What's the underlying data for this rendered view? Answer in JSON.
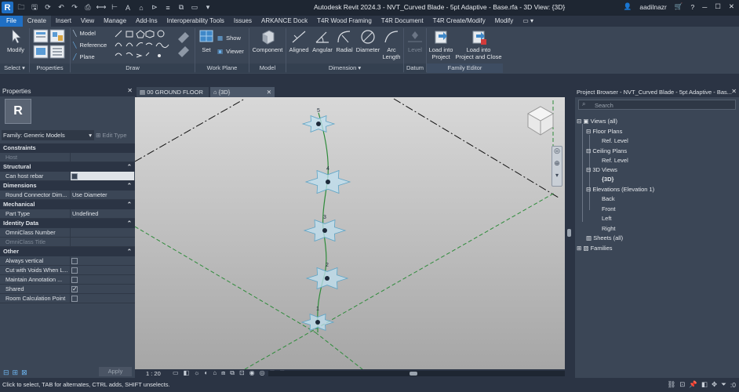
{
  "title": "Autodesk Revit 2024.3 - NVT_Curved Blade - 5pt Adaptive - Base.rfa - 3D View: {3D}",
  "user": "aadilnazr",
  "logo_letter": "R",
  "menu_tabs": [
    "File",
    "Create",
    "Insert",
    "View",
    "Manage",
    "Add-Ins",
    "Interoperability Tools",
    "Issues",
    "ARKANCE Dock",
    "T4R Wood Framing",
    "T4R Document",
    "T4R Create/Modify",
    "Modify"
  ],
  "ribbon": {
    "modify": "Modify",
    "model": "Model",
    "reference": "Reference",
    "plane": "Plane",
    "set": "Set",
    "show": "Show",
    "viewer": "Viewer",
    "component": "Component",
    "aligned": "Aligned",
    "angular": "Angular",
    "radial": "Radial",
    "diameter": "Diameter",
    "arc_length": [
      "Arc",
      "Length"
    ],
    "level": "Level",
    "load_into_project": [
      "Load into",
      "Project"
    ],
    "load_into_project_close": [
      "Load into",
      "Project and Close"
    ],
    "panels": {
      "select": "Select",
      "properties": "Properties",
      "draw": "Draw",
      "work_plane": "Work Plane",
      "model": "Model",
      "dimension": "Dimension",
      "datum": "Datum",
      "family_editor": "Family Editor"
    }
  },
  "properties": {
    "title": "Properties",
    "family": "Family: Generic Models",
    "edit_type": "Edit Type",
    "apply": "Apply",
    "sections": {
      "constraints": "Constraints",
      "structural": "Structural",
      "dimensions": "Dimensions",
      "mechanical": "Mechanical",
      "identity": "Identity Data",
      "other": "Other"
    },
    "rows": {
      "host": "Host",
      "can_host_rebar": "Can host rebar",
      "round_connector": "Round Connector Dim...",
      "round_connector_val": "Use Diameter",
      "part_type": "Part Type",
      "part_type_val": "Undefined",
      "omniclass_number": "OmniClass Number",
      "omniclass_title": "OmniClass Title",
      "always_vertical": "Always vertical",
      "cut_with_voids": "Cut with Voids When L...",
      "maintain_annotation": "Maintain Annotation ...",
      "shared": "Shared",
      "room_calc_point": "Room Calculation Point"
    },
    "checks": {
      "can_host_rebar": false,
      "always_vertical": false,
      "cut_with_voids": false,
      "maintain_annotation": false,
      "shared": true,
      "room_calc_point": false
    }
  },
  "view_tabs": [
    "00 GROUND FLOOR",
    "{3D}"
  ],
  "view_scale": "1 : 20",
  "points": [
    "5",
    "4",
    "3",
    "2",
    "1"
  ],
  "browser": {
    "title": "Project Browser - NVT_Curved Blade - 5pt Adaptive - Bas...",
    "search_placeholder": "Search",
    "views_all": "Views (all)",
    "floor_plans": "Floor Plans",
    "ref_level_1": "Ref. Level",
    "ceiling_plans": "Ceiling Plans",
    "ref_level_2": "Ref. Level",
    "views_3d": "3D Views",
    "view_3d": "{3D}",
    "elevations": "Elevations (Elevation 1)",
    "back": "Back",
    "front": "Front",
    "left": "Left",
    "right": "Right",
    "sheets": "Sheets (all)",
    "families": "Families"
  },
  "status": "Click to select, TAB for alternates, CTRL adds, SHIFT unselects.",
  "status_filter_count": ":0",
  "colors": {
    "file_tab": "#1f6fc4",
    "panel": "#3b4656",
    "dark": "#2b3444",
    "point": "#bfe0f0",
    "path": "#2e8b3a"
  }
}
